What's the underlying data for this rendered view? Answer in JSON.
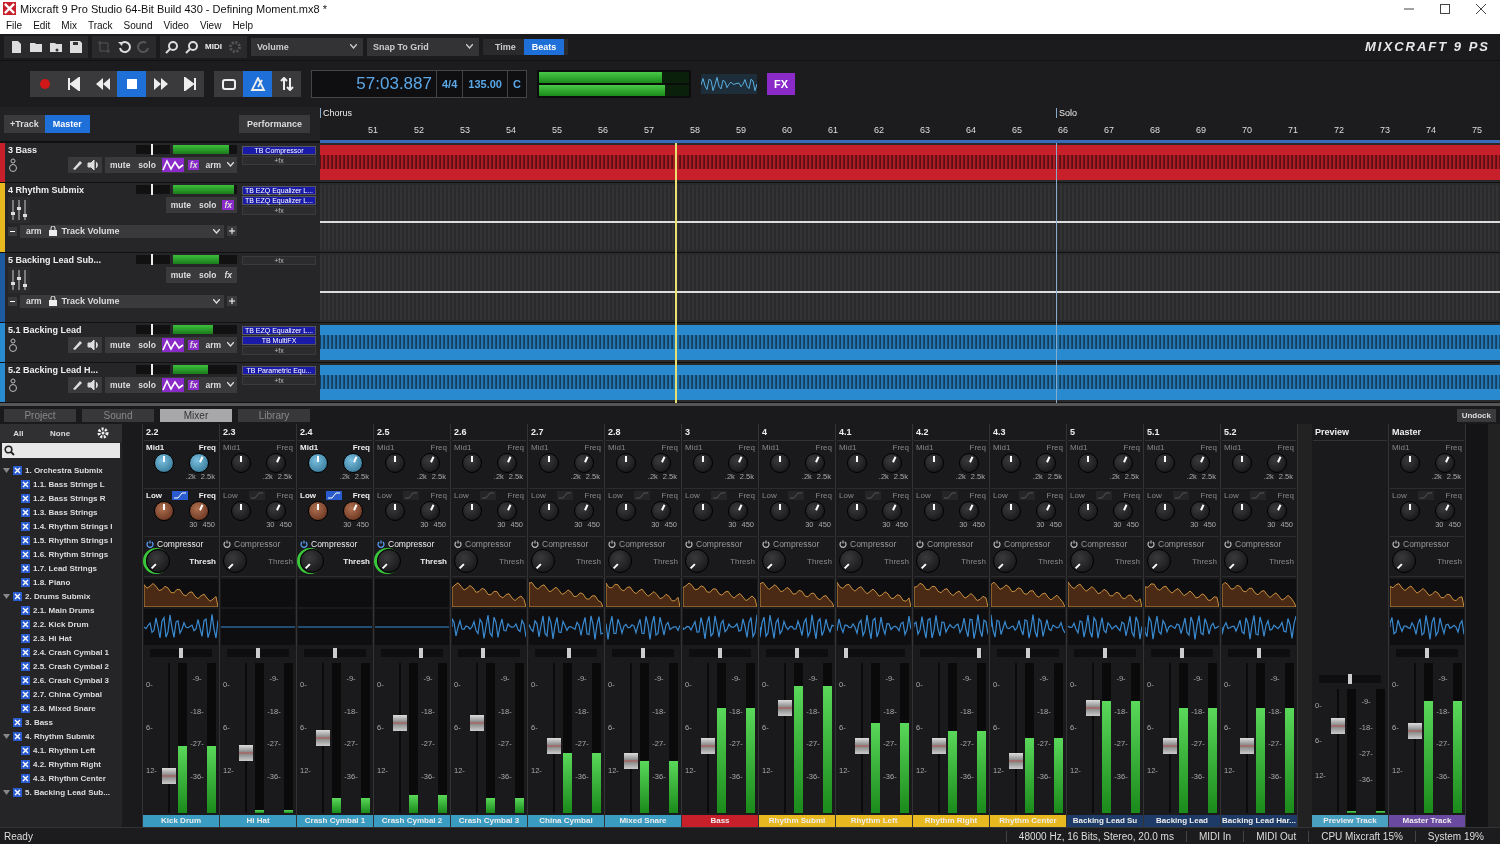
{
  "window": {
    "title": "Mixcraft 9 Pro Studio 64-Bit Build 430 - Defining Moment.mx8 *"
  },
  "menu": [
    "File",
    "Edit",
    "Mix",
    "Track",
    "Sound",
    "Video",
    "View",
    "Help"
  ],
  "toolbar": {
    "automation_dropdown": "Volume",
    "snap_dropdown": "Snap To Grid",
    "midi_label": "MIDI",
    "logo": "MIXCRAFT 9 PS",
    "time_modes": [
      {
        "label": "Time",
        "selected": false
      },
      {
        "label": "Beats",
        "selected": true
      }
    ]
  },
  "transport": {
    "buttons": [
      {
        "kind": "record",
        "selected": false
      },
      {
        "kind": "to-start",
        "selected": false
      },
      {
        "kind": "rewind",
        "selected": false
      },
      {
        "kind": "stop",
        "selected": true
      },
      {
        "kind": "forward",
        "selected": false
      },
      {
        "kind": "to-end",
        "selected": false
      }
    ],
    "modes": [
      {
        "kind": "loop",
        "selected": false
      },
      {
        "kind": "metronome",
        "selected": true
      },
      {
        "kind": "sync",
        "selected": false
      }
    ],
    "time": "57:03.887",
    "signature": "4/4",
    "tempo": "135.00",
    "key": "C",
    "meters": [
      {
        "level": 0.82
      },
      {
        "level": 0.84
      }
    ],
    "fx_label": "FX"
  },
  "track_panel": {
    "add_track": "+Track",
    "master": "Master",
    "performance": "Performance"
  },
  "ruler": {
    "start_marker": "Chorus",
    "bars": [
      {
        "label": "51"
      },
      {
        "label": "52"
      },
      {
        "label": "53"
      },
      {
        "label": "54"
      },
      {
        "label": "55"
      },
      {
        "label": "56"
      },
      {
        "label": "57"
      },
      {
        "label": "58"
      },
      {
        "label": "59"
      },
      {
        "label": "60"
      },
      {
        "label": "61"
      },
      {
        "label": "62"
      },
      {
        "label": "63"
      },
      {
        "label": "64"
      },
      {
        "label": "65"
      },
      {
        "label": "66",
        "marker": "Solo"
      },
      {
        "label": "67"
      },
      {
        "label": "68"
      },
      {
        "label": "69"
      },
      {
        "label": "70"
      },
      {
        "label": "71"
      },
      {
        "label": "72"
      },
      {
        "label": "73"
      },
      {
        "label": "74"
      },
      {
        "label": "75"
      }
    ]
  },
  "tracks": [
    {
      "name": "3 Bass",
      "color": "#c8202a",
      "kind": "track",
      "fx_active": true,
      "controls": [
        "mute",
        "solo",
        "fx",
        "arm"
      ],
      "volume": {
        "level": 0.45
      },
      "meter": {
        "level": 0.88
      },
      "effects": [
        "TB Compressor"
      ],
      "add_fx": "+fx"
    },
    {
      "name": "4 Rhythm Submix",
      "color": "#e8b820",
      "kind": "submix",
      "fx_active": true,
      "controls": [
        "mute",
        "solo",
        "fx",
        "arm"
      ],
      "automation": "Track Volume",
      "volume": {
        "level": 0.45
      },
      "meter": {
        "level": 0.95
      },
      "effects": [
        "TB EZQ Equalizer L...",
        "TB EZQ Equalizer L..."
      ],
      "add_fx": "+fx"
    },
    {
      "name": "5 Backing Lead Sub...",
      "color": "#1e5aa0",
      "kind": "submix",
      "fx_active": false,
      "controls": [
        "mute",
        "solo",
        "fx",
        "arm"
      ],
      "automation": "Track Volume",
      "volume": {
        "level": 0.45
      },
      "meter": {
        "level": 0.72
      },
      "add_fx": "+fx"
    },
    {
      "name": "5.1 Backing Lead",
      "color": "#2a8ad0",
      "kind": "track",
      "fx_active": true,
      "controls": [
        "mute",
        "solo",
        "fx",
        "arm"
      ],
      "volume": {
        "level": 0.45
      },
      "meter": {
        "level": 0.62
      },
      "effects": [
        "TB EZQ Equalizer L...",
        "TB MultiFX"
      ],
      "add_fx": "+fx"
    },
    {
      "name": "5.2 Backing Lead H...",
      "color": "#2a8ad0",
      "kind": "track",
      "fx_active": true,
      "controls": [
        "mute",
        "solo",
        "fx",
        "arm"
      ],
      "volume": {
        "level": 0.45
      },
      "meter": {
        "level": 0.55
      },
      "effects": [
        "TB Parametric Equ..."
      ],
      "add_fx": "+fx"
    }
  ],
  "tabs": [
    {
      "label": "Project",
      "selected": false
    },
    {
      "label": "Sound",
      "selected": false
    },
    {
      "label": "Mixer",
      "selected": true
    },
    {
      "label": "Library",
      "selected": false
    }
  ],
  "undock": "Undock",
  "mixer_filter": {
    "all": "All",
    "none": "None"
  },
  "mixer_tree": [
    {
      "label": "1. Orchestra Submix",
      "checked": true,
      "expanded": true,
      "children": [
        {
          "label": "1.1. Bass Strings L",
          "checked": true
        },
        {
          "label": "1.2. Bass Strings R",
          "checked": true
        },
        {
          "label": "1.3. Bass Strings",
          "checked": true
        },
        {
          "label": "1.4. Rhythm Strings I",
          "checked": true
        },
        {
          "label": "1.5. Rhythm Strings I",
          "checked": true
        },
        {
          "label": "1.6. Rhythm Strings",
          "checked": true
        },
        {
          "label": "1.7. Lead Strings",
          "checked": true
        },
        {
          "label": "1.8. Piano",
          "checked": true
        }
      ]
    },
    {
      "label": "2. Drums Submix",
      "checked": true,
      "expanded": true,
      "children": [
        {
          "label": "2.1. Main Drums",
          "checked": true
        },
        {
          "label": "2.2. Kick Drum",
          "checked": true
        },
        {
          "label": "2.3. Hi Hat",
          "checked": true
        },
        {
          "label": "2.4. Crash Cymbal 1",
          "checked": true
        },
        {
          "label": "2.5. Crash Cymbal 2",
          "checked": true
        },
        {
          "label": "2.6. Crash Cymbal 3",
          "checked": true
        },
        {
          "label": "2.7. China Cymbal",
          "checked": true
        },
        {
          "label": "2.8. Mixed Snare",
          "checked": true
        }
      ]
    },
    {
      "label": "3. Bass",
      "checked": true,
      "expanded": false
    },
    {
      "label": "4. Rhythm Submix",
      "checked": true,
      "expanded": true,
      "children": [
        {
          "label": "4.1. Rhythm Left",
          "checked": true
        },
        {
          "label": "4.2. Rhythm Right",
          "checked": true
        },
        {
          "label": "4.3. Rhythm Center",
          "checked": true
        }
      ]
    },
    {
      "label": "5. Backing Lead Sub...",
      "checked": true,
      "expanded": true
    }
  ],
  "strips": [
    {
      "number": "2.2",
      "name": "Kick Drum",
      "color": "#3a9cc0",
      "kind": "channel",
      "eq_on": true,
      "comp_on": true,
      "active": true,
      "labels": {
        "mid": "Mid1",
        "mid_freq": "Freq",
        "mid_min": ".2k",
        "mid_max": "2.5k",
        "low": "Low",
        "low_freq": "Freq",
        "low_min": "30",
        "low_max": "450",
        "compressor": "Compressor",
        "thresh": "Thresh"
      },
      "scale_left": [
        "0-",
        "6-",
        "12-"
      ],
      "scale_right": [
        "-9-",
        "-18-",
        "-27-",
        "-36-"
      ],
      "pan": {
        "level": 0.5
      },
      "fader": {
        "level": 0.25
      },
      "meter": {
        "level": 0.45
      }
    },
    {
      "number": "2.3",
      "name": "Hi Hat",
      "color": "#3a9cc0",
      "kind": "channel",
      "eq_on": false,
      "comp_on": false,
      "active": false,
      "labels": {
        "mid": "Mid1",
        "mid_freq": "Freq",
        "mid_min": ".2k",
        "mid_max": "2.5k",
        "low": "Low",
        "low_freq": "Freq",
        "low_min": "30",
        "low_max": "450",
        "compressor": "Compressor",
        "thresh": "Thresh"
      },
      "scale_left": [
        "0-",
        "6-",
        "12-"
      ],
      "scale_right": [
        "-9-",
        "-18-",
        "-27-",
        "-36-"
      ],
      "pan": {
        "level": 0.5
      },
      "fader": {
        "level": 0.4
      },
      "meter": {
        "level": 0.02
      }
    },
    {
      "number": "2.4",
      "name": "Crash Cymbal 1",
      "color": "#3a9cc0",
      "kind": "channel",
      "eq_on": true,
      "comp_on": true,
      "active": false,
      "labels": {
        "mid": "Mid1",
        "mid_freq": "Freq",
        "mid_min": ".2k",
        "mid_max": "2.5k",
        "low": "Low",
        "low_freq": "Freq",
        "low_min": "30",
        "low_max": "450",
        "compressor": "Compressor",
        "thresh": "Thresh"
      },
      "scale_left": [
        "0-",
        "6-",
        "12-"
      ],
      "scale_right": [
        "-9-",
        "-18-",
        "-27-",
        "-36-"
      ],
      "pan": {
        "level": 0.5
      },
      "fader": {
        "level": 0.5
      },
      "meter": {
        "level": 0.1
      }
    },
    {
      "number": "2.5",
      "name": "Crash Cymbal 2",
      "color": "#3a9cc0",
      "kind": "channel",
      "eq_on": false,
      "comp_on": true,
      "active": false,
      "labels": {
        "mid": "Mid1",
        "mid_freq": "Freq",
        "mid_min": ".2k",
        "mid_max": "2.5k",
        "low": "Low",
        "low_freq": "Freq",
        "low_min": "30",
        "low_max": "450",
        "compressor": "Compressor",
        "thresh": "Thresh"
      },
      "scale_left": [
        "0-",
        "6-",
        "12-"
      ],
      "scale_right": [
        "-9-",
        "-18-",
        "-27-",
        "-36-"
      ],
      "pan": {
        "level": 0.65
      },
      "fader": {
        "level": 0.6
      },
      "meter": {
        "level": 0.12
      }
    },
    {
      "number": "2.6",
      "name": "Crash Cymbal 3",
      "color": "#3a9cc0",
      "kind": "channel",
      "eq_on": false,
      "comp_on": false,
      "active": true,
      "labels": {
        "mid": "Mid1",
        "mid_freq": "Freq",
        "mid_min": ".2k",
        "mid_max": "2.5k",
        "low": "Low",
        "low_freq": "Freq",
        "low_min": "30",
        "low_max": "450",
        "compressor": "Compressor",
        "thresh": "Thresh"
      },
      "scale_left": [
        "0-",
        "6-",
        "12-"
      ],
      "scale_right": [
        "-9-",
        "-18-",
        "-27-",
        "-36-"
      ],
      "pan": {
        "level": 0.4
      },
      "fader": {
        "level": 0.6
      },
      "meter": {
        "level": 0.1
      }
    },
    {
      "number": "2.7",
      "name": "China Cymbal",
      "color": "#3a9cc0",
      "kind": "channel",
      "eq_on": false,
      "comp_on": false,
      "active": true,
      "labels": {
        "mid": "Mid1",
        "mid_freq": "Freq",
        "mid_min": ".2k",
        "mid_max": "2.5k",
        "low": "Low",
        "low_freq": "Freq",
        "low_min": "30",
        "low_max": "450",
        "compressor": "Compressor",
        "thresh": "Thresh"
      },
      "scale_left": [
        "0-",
        "6-",
        "12-"
      ],
      "scale_right": [
        "-9-",
        "-18-",
        "-27-",
        "-36-"
      ],
      "pan": {
        "level": 0.55
      },
      "fader": {
        "level": 0.45
      },
      "meter": {
        "level": 0.4
      }
    },
    {
      "number": "2.8",
      "name": "Mixed Snare",
      "color": "#3a9cc0",
      "kind": "channel",
      "eq_on": false,
      "comp_on": false,
      "active": true,
      "labels": {
        "mid": "Mid1",
        "mid_freq": "Freq",
        "mid_min": ".2k",
        "mid_max": "2.5k",
        "low": "Low",
        "low_freq": "Freq",
        "low_min": "30",
        "low_max": "450",
        "compressor": "Compressor",
        "thresh": "Thresh"
      },
      "scale_left": [
        "0-",
        "6-",
        "12-"
      ],
      "scale_right": [
        "-9-",
        "-18-",
        "-27-",
        "-36-"
      ],
      "pan": {
        "level": 0.5
      },
      "fader": {
        "level": 0.35
      },
      "meter": {
        "level": 0.35
      }
    },
    {
      "number": "3",
      "name": "Bass",
      "color": "#c8202a",
      "kind": "channel",
      "eq_on": false,
      "comp_on": false,
      "active": true,
      "labels": {
        "mid": "Mid1",
        "mid_freq": "Freq",
        "mid_min": ".2k",
        "mid_max": "2.5k",
        "low": "Low",
        "low_freq": "Freq",
        "low_min": "30",
        "low_max": "450",
        "compressor": "Compressor",
        "thresh": "Thresh"
      },
      "scale_left": [
        "0-",
        "6-",
        "12-"
      ],
      "scale_right": [
        "-9-",
        "-18-",
        "-27-",
        "-36-"
      ],
      "pan": {
        "level": 0.5
      },
      "fader": {
        "level": 0.45
      },
      "meter": {
        "level": 0.7
      }
    },
    {
      "number": "4",
      "name": "Rhythm Submi",
      "color": "#e8b820",
      "kind": "channel",
      "eq_on": false,
      "comp_on": false,
      "active": true,
      "labels": {
        "mid": "Mid1",
        "mid_freq": "Freq",
        "mid_min": ".2k",
        "mid_max": "2.5k",
        "low": "Low",
        "low_freq": "Freq",
        "low_min": "30",
        "low_max": "450",
        "compressor": "Compressor",
        "thresh": "Thresh"
      },
      "scale_left": [
        "0-",
        "6-",
        "12-"
      ],
      "scale_right": [
        "-9-",
        "-18-",
        "-27-",
        "-36-"
      ],
      "pan": {
        "level": 0.5
      },
      "fader": {
        "level": 0.7
      },
      "meter": {
        "level": 0.85
      }
    },
    {
      "number": "4.1",
      "name": "Rhythm Left",
      "color": "#e8b820",
      "kind": "channel",
      "eq_on": false,
      "comp_on": false,
      "active": true,
      "labels": {
        "mid": "Mid1",
        "mid_freq": "Freq",
        "mid_min": ".2k",
        "mid_max": "2.5k",
        "low": "Low",
        "low_freq": "Freq",
        "low_min": "30",
        "low_max": "450",
        "compressor": "Compressor",
        "thresh": "Thresh"
      },
      "scale_left": [
        "0-",
        "6-",
        "12-"
      ],
      "scale_right": [
        "-9-",
        "-18-",
        "-27-",
        "-36-"
      ],
      "pan": {
        "level": 0.05
      },
      "fader": {
        "level": 0.45
      },
      "meter": {
        "level": 0.6
      }
    },
    {
      "number": "4.2",
      "name": "Rhythm Right",
      "color": "#e8b820",
      "kind": "channel",
      "eq_on": false,
      "comp_on": false,
      "active": true,
      "labels": {
        "mid": "Mid1",
        "mid_freq": "Freq",
        "mid_min": ".2k",
        "mid_max": "2.5k",
        "low": "Low",
        "low_freq": "Freq",
        "low_min": "30",
        "low_max": "450",
        "compressor": "Compressor",
        "thresh": "Thresh"
      },
      "scale_left": [
        "0-",
        "6-",
        "12-"
      ],
      "scale_right": [
        "-9-",
        "-18-",
        "-27-",
        "-36-"
      ],
      "pan": {
        "level": 0.95
      },
      "fader": {
        "level": 0.45
      },
      "meter": {
        "level": 0.55
      }
    },
    {
      "number": "4.3",
      "name": "Rhythm Center",
      "color": "#e8b820",
      "kind": "channel",
      "eq_on": false,
      "comp_on": false,
      "active": true,
      "labels": {
        "mid": "Mid1",
        "mid_freq": "Freq",
        "mid_min": ".2k",
        "mid_max": "2.5k",
        "low": "Low",
        "low_freq": "Freq",
        "low_min": "30",
        "low_max": "450",
        "compressor": "Compressor",
        "thresh": "Thresh"
      },
      "scale_left": [
        "0-",
        "6-",
        "12-"
      ],
      "scale_right": [
        "-9-",
        "-18-",
        "-27-",
        "-36-"
      ],
      "pan": {
        "level": 0.5
      },
      "fader": {
        "level": 0.35
      },
      "meter": {
        "level": 0.5
      }
    },
    {
      "number": "5",
      "name": "Backing Lead Su",
      "color": "#1e3a66",
      "kind": "channel",
      "eq_on": false,
      "comp_on": false,
      "active": true,
      "labels": {
        "mid": "Mid1",
        "mid_freq": "Freq",
        "mid_min": ".2k",
        "mid_max": "2.5k",
        "low": "Low",
        "low_freq": "Freq",
        "low_min": "30",
        "low_max": "450",
        "compressor": "Compressor",
        "thresh": "Thresh"
      },
      "scale_left": [
        "0-",
        "6-",
        "12-"
      ],
      "scale_right": [
        "-9-",
        "-18-",
        "-27-",
        "-36-"
      ],
      "pan": {
        "level": 0.5
      },
      "fader": {
        "level": 0.7
      },
      "meter": {
        "level": 0.75
      }
    },
    {
      "number": "5.1",
      "name": "Backing Lead",
      "color": "#1e3a66",
      "kind": "channel",
      "eq_on": false,
      "comp_on": false,
      "active": true,
      "labels": {
        "mid": "Mid1",
        "mid_freq": "Freq",
        "mid_min": ".2k",
        "mid_max": "2.5k",
        "low": "Low",
        "low_freq": "Freq",
        "low_min": "30",
        "low_max": "450",
        "compressor": "Compressor",
        "thresh": "Thresh"
      },
      "scale_left": [
        "0-",
        "6-",
        "12-"
      ],
      "scale_right": [
        "-9-",
        "-18-",
        "-27-",
        "-36-"
      ],
      "pan": {
        "level": 0.5
      },
      "fader": {
        "level": 0.45
      },
      "meter": {
        "level": 0.7
      }
    },
    {
      "number": "5.2",
      "name": "Backing Lead Har...",
      "color": "#1e3a66",
      "kind": "channel",
      "eq_on": false,
      "comp_on": false,
      "active": true,
      "labels": {
        "mid": "Mid1",
        "mid_freq": "Freq",
        "mid_min": ".2k",
        "mid_max": "2.5k",
        "low": "Low",
        "low_freq": "Freq",
        "low_min": "30",
        "low_max": "450",
        "compressor": "Compressor",
        "thresh": "Thresh"
      },
      "scale_left": [
        "0-",
        "6-",
        "12-"
      ],
      "scale_right": [
        "-9-",
        "-18-",
        "-27-",
        "-36-"
      ],
      "pan": {
        "level": 0.5
      },
      "fader": {
        "level": 0.45
      },
      "meter": {
        "level": 0.7
      }
    },
    {
      "number": "Preview",
      "name": "Preview Track",
      "color": "#4aa0c0",
      "kind": "preview",
      "scale_left": [
        "0-",
        "6-",
        "12-"
      ],
      "scale_right": [
        "-9-",
        "-18-",
        "-27-",
        "-36-"
      ],
      "pan": {
        "level": 0.5
      },
      "fader": {
        "level": 0.7
      },
      "meter": {
        "level": 0.02
      }
    },
    {
      "number": "Master",
      "name": "Master Track",
      "color": "#6a4aa0",
      "kind": "channel",
      "eq_on": false,
      "comp_on": false,
      "active": true,
      "labels": {
        "mid": "Mid1",
        "mid_freq": "Freq",
        "mid_min": ".2k",
        "mid_max": "2.5k",
        "low": "Low",
        "low_freq": "Freq",
        "low_min": "30",
        "low_max": "450",
        "compressor": "Compressor",
        "thresh": "Thresh"
      },
      "scale_left": [
        "0-",
        "6-",
        "12-"
      ],
      "scale_right": [
        "-9-",
        "-18-",
        "-27-",
        "-36-"
      ],
      "pan": {
        "level": 0.5
      },
      "fader": {
        "level": 0.55
      },
      "meter": {
        "level": 0.75
      }
    }
  ],
  "status_bar": {
    "message": "Ready",
    "audio_format": "48000 Hz, 16 Bits, Stereo, 20.0 ms",
    "midi_in": "MIDI In",
    "midi_out": "MIDI Out",
    "cpu": "CPU Mixcraft 15%",
    "system": "System 19%"
  }
}
